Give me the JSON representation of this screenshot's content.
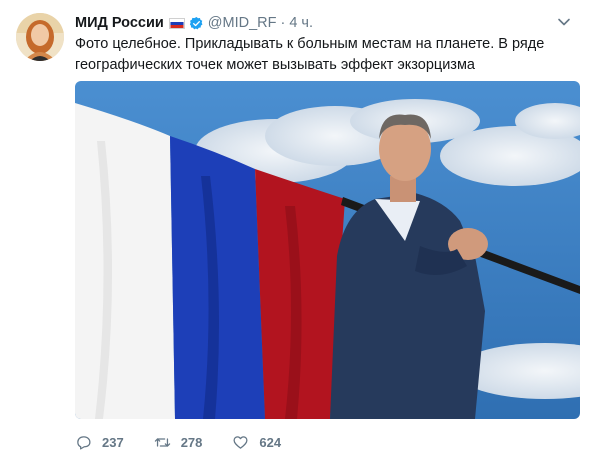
{
  "tweet": {
    "display_name": "МИД России",
    "flag_emoji": "russia-flag-icon",
    "verified": true,
    "handle": "@MID_RF",
    "separator": "·",
    "time": "4 ч.",
    "text": "Фото целебное. Прикладывать к больным местам на планете. В ряде географических точек может вызывать эффект экзорцизма"
  },
  "actions": {
    "reply_count": "237",
    "retweet_count": "278",
    "like_count": "624"
  },
  "icons": {
    "reply": "reply-icon",
    "retweet": "retweet-icon",
    "like": "heart-icon",
    "caret": "chevron-down-icon",
    "verified": "verified-badge-icon"
  },
  "colors": {
    "verified_blue": "#1da1f2",
    "muted_text": "#657786",
    "flag_white": "#f4f4f4",
    "flag_blue": "#1d3fb8",
    "flag_red": "#b2141f",
    "sky": "#3f86c9"
  }
}
